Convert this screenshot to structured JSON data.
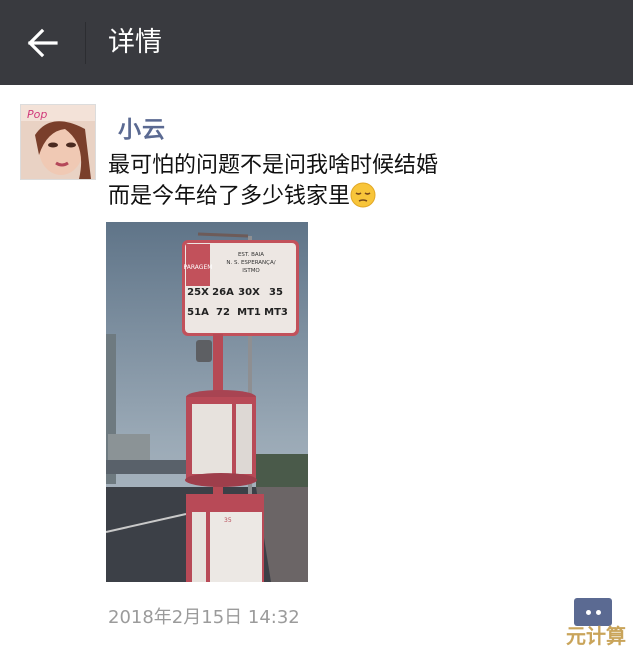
{
  "header": {
    "title": "详情",
    "back_icon": "arrow-left-icon"
  },
  "post": {
    "username": "小云",
    "text_line1": "最可怕的问题不是问我啥时候结婚",
    "text_line2": "而是今年给了多少钱家里",
    "emoji": "pensive-face-icon",
    "timestamp": "2018年2月15日 14:32"
  },
  "photo": {
    "sign_header": "PARAGEM",
    "sign_stop_lines": [
      "EST. BAIA",
      "N. S. ESPERANÇA/",
      "ISTMO"
    ],
    "routes_row1": [
      "25X",
      "26A",
      "30X",
      "35"
    ],
    "routes_row2": [
      "51A",
      "72",
      "MT1",
      "MT3"
    ],
    "lower_panel_label": "35"
  },
  "watermark": "元计算",
  "colors": {
    "topbar": "#393a3f",
    "username": "#5b6a92",
    "timestamp": "#9b9b9b"
  }
}
